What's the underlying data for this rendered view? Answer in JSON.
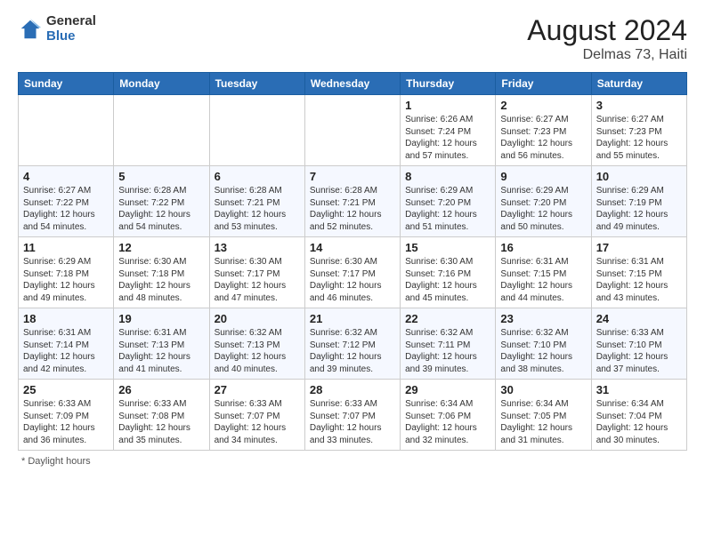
{
  "header": {
    "logo_general": "General",
    "logo_blue": "Blue",
    "month_year": "August 2024",
    "location": "Delmas 73, Haiti"
  },
  "days_of_week": [
    "Sunday",
    "Monday",
    "Tuesday",
    "Wednesday",
    "Thursday",
    "Friday",
    "Saturday"
  ],
  "weeks": [
    [
      {
        "day": "",
        "info": ""
      },
      {
        "day": "",
        "info": ""
      },
      {
        "day": "",
        "info": ""
      },
      {
        "day": "",
        "info": ""
      },
      {
        "day": "1",
        "info": "Sunrise: 6:26 AM\nSunset: 7:24 PM\nDaylight: 12 hours and 57 minutes."
      },
      {
        "day": "2",
        "info": "Sunrise: 6:27 AM\nSunset: 7:23 PM\nDaylight: 12 hours and 56 minutes."
      },
      {
        "day": "3",
        "info": "Sunrise: 6:27 AM\nSunset: 7:23 PM\nDaylight: 12 hours and 55 minutes."
      }
    ],
    [
      {
        "day": "4",
        "info": "Sunrise: 6:27 AM\nSunset: 7:22 PM\nDaylight: 12 hours and 54 minutes."
      },
      {
        "day": "5",
        "info": "Sunrise: 6:28 AM\nSunset: 7:22 PM\nDaylight: 12 hours and 54 minutes."
      },
      {
        "day": "6",
        "info": "Sunrise: 6:28 AM\nSunset: 7:21 PM\nDaylight: 12 hours and 53 minutes."
      },
      {
        "day": "7",
        "info": "Sunrise: 6:28 AM\nSunset: 7:21 PM\nDaylight: 12 hours and 52 minutes."
      },
      {
        "day": "8",
        "info": "Sunrise: 6:29 AM\nSunset: 7:20 PM\nDaylight: 12 hours and 51 minutes."
      },
      {
        "day": "9",
        "info": "Sunrise: 6:29 AM\nSunset: 7:20 PM\nDaylight: 12 hours and 50 minutes."
      },
      {
        "day": "10",
        "info": "Sunrise: 6:29 AM\nSunset: 7:19 PM\nDaylight: 12 hours and 49 minutes."
      }
    ],
    [
      {
        "day": "11",
        "info": "Sunrise: 6:29 AM\nSunset: 7:18 PM\nDaylight: 12 hours and 49 minutes."
      },
      {
        "day": "12",
        "info": "Sunrise: 6:30 AM\nSunset: 7:18 PM\nDaylight: 12 hours and 48 minutes."
      },
      {
        "day": "13",
        "info": "Sunrise: 6:30 AM\nSunset: 7:17 PM\nDaylight: 12 hours and 47 minutes."
      },
      {
        "day": "14",
        "info": "Sunrise: 6:30 AM\nSunset: 7:17 PM\nDaylight: 12 hours and 46 minutes."
      },
      {
        "day": "15",
        "info": "Sunrise: 6:30 AM\nSunset: 7:16 PM\nDaylight: 12 hours and 45 minutes."
      },
      {
        "day": "16",
        "info": "Sunrise: 6:31 AM\nSunset: 7:15 PM\nDaylight: 12 hours and 44 minutes."
      },
      {
        "day": "17",
        "info": "Sunrise: 6:31 AM\nSunset: 7:15 PM\nDaylight: 12 hours and 43 minutes."
      }
    ],
    [
      {
        "day": "18",
        "info": "Sunrise: 6:31 AM\nSunset: 7:14 PM\nDaylight: 12 hours and 42 minutes."
      },
      {
        "day": "19",
        "info": "Sunrise: 6:31 AM\nSunset: 7:13 PM\nDaylight: 12 hours and 41 minutes."
      },
      {
        "day": "20",
        "info": "Sunrise: 6:32 AM\nSunset: 7:13 PM\nDaylight: 12 hours and 40 minutes."
      },
      {
        "day": "21",
        "info": "Sunrise: 6:32 AM\nSunset: 7:12 PM\nDaylight: 12 hours and 39 minutes."
      },
      {
        "day": "22",
        "info": "Sunrise: 6:32 AM\nSunset: 7:11 PM\nDaylight: 12 hours and 39 minutes."
      },
      {
        "day": "23",
        "info": "Sunrise: 6:32 AM\nSunset: 7:10 PM\nDaylight: 12 hours and 38 minutes."
      },
      {
        "day": "24",
        "info": "Sunrise: 6:33 AM\nSunset: 7:10 PM\nDaylight: 12 hours and 37 minutes."
      }
    ],
    [
      {
        "day": "25",
        "info": "Sunrise: 6:33 AM\nSunset: 7:09 PM\nDaylight: 12 hours and 36 minutes."
      },
      {
        "day": "26",
        "info": "Sunrise: 6:33 AM\nSunset: 7:08 PM\nDaylight: 12 hours and 35 minutes."
      },
      {
        "day": "27",
        "info": "Sunrise: 6:33 AM\nSunset: 7:07 PM\nDaylight: 12 hours and 34 minutes."
      },
      {
        "day": "28",
        "info": "Sunrise: 6:33 AM\nSunset: 7:07 PM\nDaylight: 12 hours and 33 minutes."
      },
      {
        "day": "29",
        "info": "Sunrise: 6:34 AM\nSunset: 7:06 PM\nDaylight: 12 hours and 32 minutes."
      },
      {
        "day": "30",
        "info": "Sunrise: 6:34 AM\nSunset: 7:05 PM\nDaylight: 12 hours and 31 minutes."
      },
      {
        "day": "31",
        "info": "Sunrise: 6:34 AM\nSunset: 7:04 PM\nDaylight: 12 hours and 30 minutes."
      }
    ]
  ],
  "footer": {
    "note": "Daylight hours"
  }
}
